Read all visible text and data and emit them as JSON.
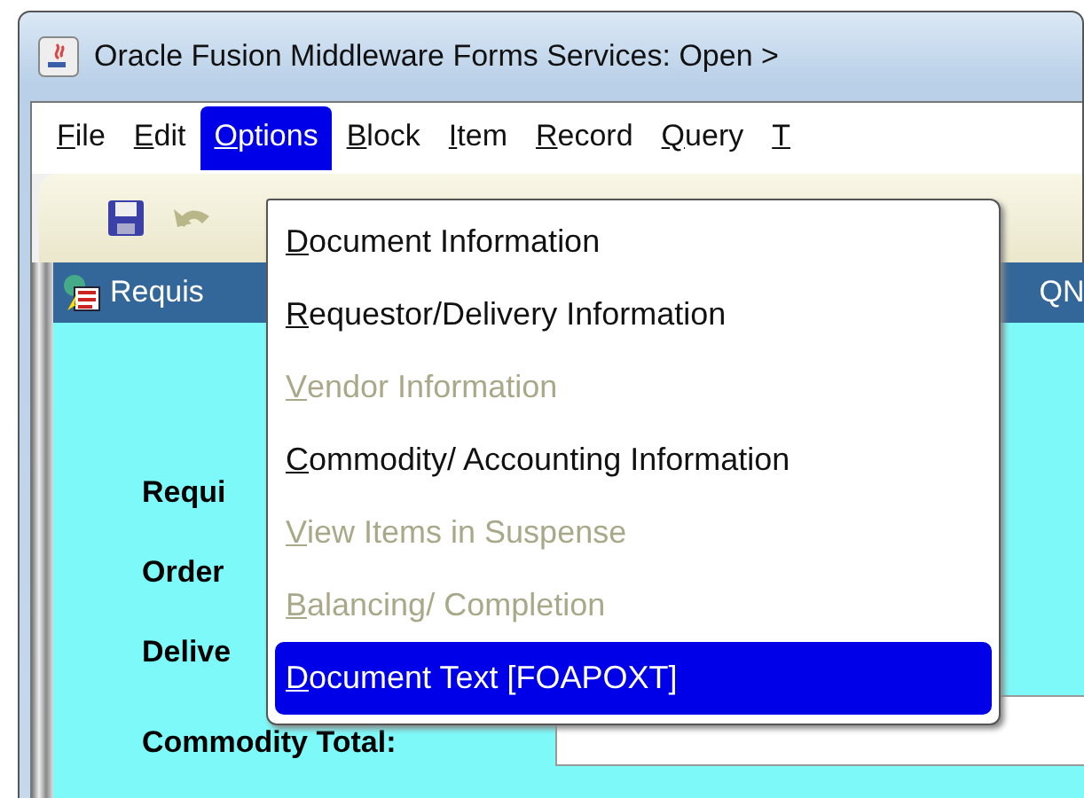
{
  "window": {
    "title": "Oracle Fusion Middleware Forms Services:  Open >"
  },
  "menubar": [
    {
      "label": "File",
      "selected": false
    },
    {
      "label": "Edit",
      "selected": false
    },
    {
      "label": "Options",
      "selected": true
    },
    {
      "label": "Block",
      "selected": false
    },
    {
      "label": "Item",
      "selected": false
    },
    {
      "label": "Record",
      "selected": false
    },
    {
      "label": "Query",
      "selected": false
    },
    {
      "label": "T",
      "selected": false
    }
  ],
  "form": {
    "title": "Requis",
    "title_right": "QN",
    "labels": [
      "Requi",
      "Order",
      "Delive",
      "Commodity Total:"
    ]
  },
  "menu": [
    {
      "label": "Document Information",
      "disabled": false,
      "selected": false
    },
    {
      "label": "Requestor/Delivery Information",
      "disabled": false,
      "selected": false
    },
    {
      "label": "Vendor Information",
      "disabled": true,
      "selected": false
    },
    {
      "label": "Commodity/ Accounting Information",
      "disabled": false,
      "selected": false
    },
    {
      "label": "View Items in Suspense",
      "disabled": true,
      "selected": false
    },
    {
      "label": "Balancing/ Completion",
      "disabled": true,
      "selected": false
    },
    {
      "label": "Document Text [FOAPOXT]",
      "disabled": false,
      "selected": true
    }
  ]
}
